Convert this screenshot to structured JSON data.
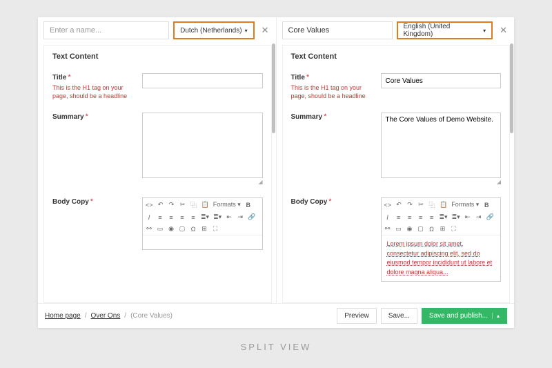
{
  "caption": "SPLIT VIEW",
  "left": {
    "name_placeholder": "Enter a name...",
    "name_value": "",
    "language": "Dutch (Netherlands)",
    "section_heading": "Text Content",
    "title_label": "Title",
    "title_hint": "This is the H1 tag on your page, should be a headline",
    "title_value": "",
    "summary_label": "Summary",
    "summary_value": "",
    "body_label": "Body Copy",
    "body_value": ""
  },
  "right": {
    "name_value": "Core Values",
    "language": "English (United Kingdom)",
    "section_heading": "Text Content",
    "title_label": "Title",
    "title_hint": "This is the H1 tag on your page, should be a headline",
    "title_value": "Core Values",
    "summary_label": "Summary",
    "summary_value": "The Core Values of Demo Website.",
    "body_label": "Body Copy",
    "body_value": "Lorem ipsum dolor sit amet, consectetur adipiscing elit, sed do eiusmod tempor incididunt ut labore et dolore magna aliqua..."
  },
  "toolbar": {
    "formats_label": "Formats"
  },
  "footer": {
    "crumb1": "Home page",
    "crumb2": "Over Ons",
    "crumb_current": "(Core Values)",
    "preview": "Preview",
    "save": "Save...",
    "publish": "Save and publish..."
  }
}
